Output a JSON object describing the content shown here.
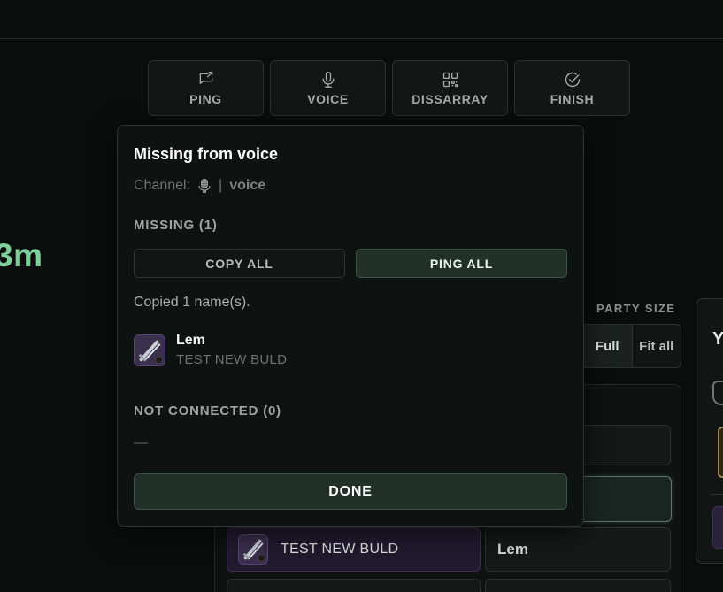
{
  "background": {
    "stat_fragment": "3m",
    "party_size_label": "PARTY SIZE",
    "party_size_options": [
      "Full",
      "Fit all"
    ],
    "right_card_title": "Y",
    "member_build": "TEST NEW BULD",
    "member_name": "Lem"
  },
  "toolbar": {
    "buttons": [
      {
        "label": "PING",
        "icon": "ping-icon"
      },
      {
        "label": "VOICE",
        "icon": "mic-icon"
      },
      {
        "label": "DISSARRAY",
        "icon": "qr-icon"
      },
      {
        "label": "FINISH",
        "icon": "check-circle-icon"
      }
    ]
  },
  "popover": {
    "title": "Missing from voice",
    "channel_prefix": "Channel:",
    "channel_separator": "|",
    "channel_name": "voice",
    "missing_header": "MISSING (1)",
    "copy_all_label": "COPY ALL",
    "ping_all_label": "PING ALL",
    "status_message": "Copied 1 name(s).",
    "missing_members": [
      {
        "name": "Lem",
        "build": "TEST NEW BULD"
      }
    ],
    "not_connected_header": "NOT CONNECTED (0)",
    "not_connected_empty": "—",
    "done_label": "DONE"
  },
  "colors": {
    "background": "#0b0d0c",
    "accent_green": "#7fcf9b",
    "button_primary": "#213029",
    "member_highlight": "#221a2e"
  }
}
